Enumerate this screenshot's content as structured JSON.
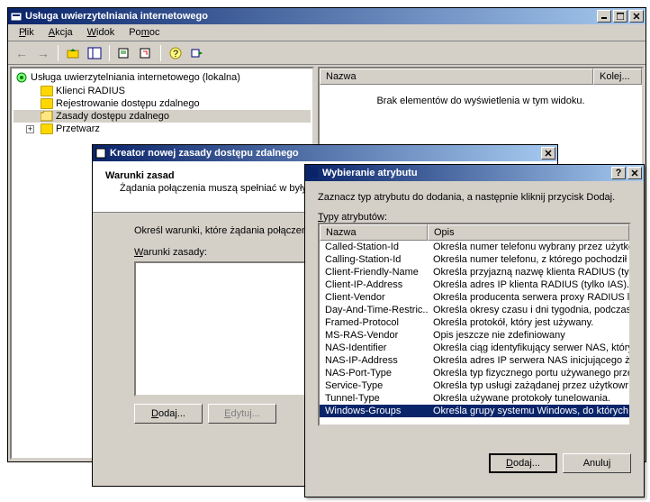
{
  "main": {
    "title": "Usługa uwierzytelniania internetowego",
    "menu": {
      "file": "Plik",
      "action": "Akcja",
      "view": "Widok",
      "help": "Pomoc"
    },
    "tree": {
      "root": "Usługa uwierzytelniania internetowego (lokalna)",
      "items": [
        "Klienci RADIUS",
        "Rejestrowanie dostępu zdalnego",
        "Zasady dostępu zdalnego",
        "Przetwarz"
      ]
    },
    "list": {
      "col_name": "Nazwa",
      "col_order": "Kolej...",
      "empty": "Brak elementów do wyświetlenia w tym widoku."
    }
  },
  "wizard": {
    "title": "Kreator nowej zasady dostępu zdalnego",
    "heading": "Warunki zasad",
    "subheading": "Żądania połączenia muszą spełniać w                                          były uwierzytelnione.",
    "instruction": "Określ warunki, które żądania połączen                odmówiono dostępu.",
    "list_label": "Warunki zasady:",
    "btn_add": "Dodaj...",
    "btn_edit": "Edytuj..."
  },
  "attr": {
    "title": "Wybieranie atrybutu",
    "instruction": "Zaznacz typ atrybutu do dodania, a następnie kliknij przycisk Dodaj.",
    "label": "Typy atrybutów:",
    "col_name": "Nazwa",
    "col_desc": "Opis",
    "rows": [
      {
        "name": "Called-Station-Id",
        "desc": "Określa numer telefonu wybrany przez użytko"
      },
      {
        "name": "Calling-Station-Id",
        "desc": "Określa numer telefonu, z którego pochodził"
      },
      {
        "name": "Client-Friendly-Name",
        "desc": "Określa przyjazną nazwę klienta RADIUS (tyl"
      },
      {
        "name": "Client-IP-Address",
        "desc": "Określa adres IP klienta RADIUS (tylko IAS)."
      },
      {
        "name": "Client-Vendor",
        "desc": "Określa producenta serwera proxy RADIUS l"
      },
      {
        "name": "Day-And-Time-Restric...",
        "desc": "Określa okresy czasu i dni tygodnia, podczas"
      },
      {
        "name": "Framed-Protocol",
        "desc": "Określa protokół, który jest używany."
      },
      {
        "name": "MS-RAS-Vendor",
        "desc": "Opis jeszcze nie zdefiniowany"
      },
      {
        "name": "NAS-Identifier",
        "desc": "Określa ciąg identyfikujący serwer NAS, który"
      },
      {
        "name": "NAS-IP-Address",
        "desc": "Określa adres IP serwera NAS inicjującego ż"
      },
      {
        "name": "NAS-Port-Type",
        "desc": "Określa typ fizycznego portu używanego prze"
      },
      {
        "name": "Service-Type",
        "desc": "Określa typ usługi zażądanej przez użytkowr"
      },
      {
        "name": "Tunnel-Type",
        "desc": "Określa używane protokoły tunelowania."
      },
      {
        "name": "Windows-Groups",
        "desc": "Określa grupy systemu Windows, do których"
      }
    ],
    "selected_index": 13,
    "btn_add": "Dodaj...",
    "btn_cancel": "Anuluj"
  }
}
